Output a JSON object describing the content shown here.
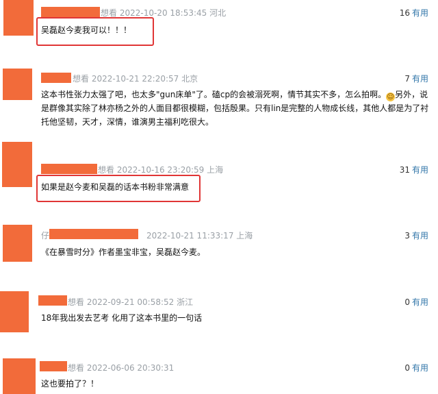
{
  "comments": [
    {
      "name_prefix": "",
      "status": "想看",
      "timestamp": "2022-10-20 18:53:45",
      "location": "河北",
      "useful_count": "16",
      "useful_label": "有用",
      "content": "吴磊赵今麦我可以！！！",
      "highlighted": true
    },
    {
      "name_prefix": "",
      "status": "想看",
      "timestamp": "2022-10-21 22:20:57",
      "location": "北京",
      "useful_count": "7",
      "useful_label": "有用",
      "content_line1": "这本书性张力太强了吧，也太多\"gun床单\"了。磕cp的会被溺死啊，情节其实不多，怎么拍啊。",
      "emoji": "sweat-smile-emoji",
      "content_line1_tail": "另外，说",
      "content_line2": "是群像其实除了林亦杨之外的人面目都很模糊，包括殷果。只有lin是完整的人物成长线，其他人都是为了衬",
      "content_line3": "托他坚韧，天才，深情，谁演男主福利吃很大。",
      "highlighted": false
    },
    {
      "name_prefix": "",
      "status": "想看",
      "timestamp": "2022-10-16 23:20:59",
      "location": "上海",
      "useful_count": "31",
      "useful_label": "有用",
      "content": "如果是赵今麦和吴磊的话本书粉非常满意",
      "highlighted": true
    },
    {
      "name_prefix": "仔",
      "status": "",
      "timestamp": "2022-10-21 11:33:17",
      "location": "上海",
      "useful_count": "3",
      "useful_label": "有用",
      "content": "《在暴雪时分》作者墨宝非宝，吴磊赵今麦。",
      "highlighted": false
    },
    {
      "name_prefix": "",
      "status": "想看",
      "timestamp": "2022-09-21 00:58:52",
      "location": "浙江",
      "useful_count": "0",
      "useful_label": "有用",
      "content": "18年我出发去艺考 化用了这本书里的一句话",
      "highlighted": false
    },
    {
      "name_prefix": "",
      "status": "想看",
      "timestamp": "2022-06-06 20:30:31",
      "location": "",
      "useful_count": "0",
      "useful_label": "有用",
      "content": "这也要拍了？！",
      "highlighted": false
    }
  ],
  "colors": {
    "redacted_orange": "#f26b3a",
    "highlight_red": "#e03535",
    "meta_gray": "#9aa0a6",
    "link_blue": "#3377aa"
  }
}
